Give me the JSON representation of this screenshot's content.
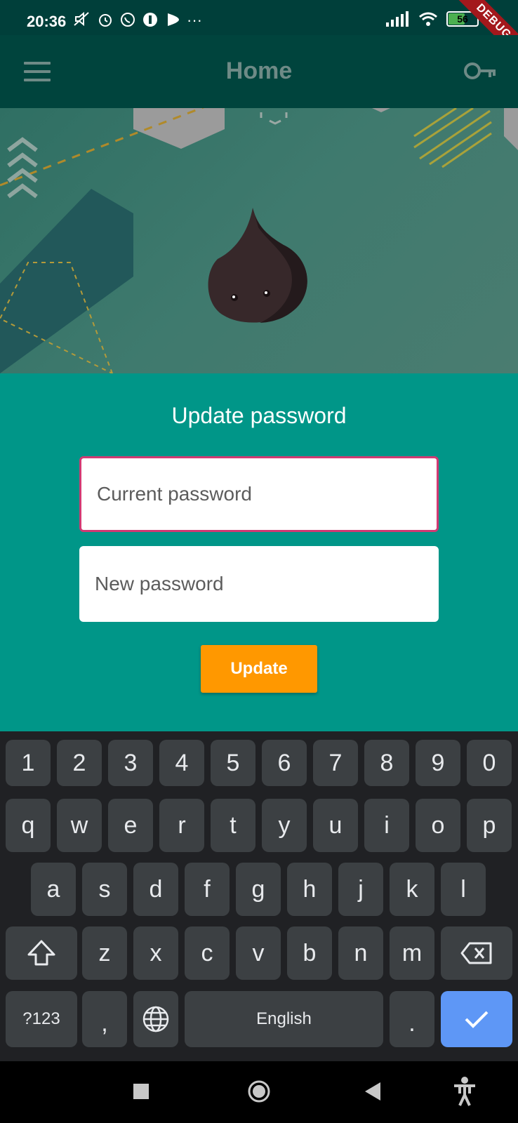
{
  "status_bar": {
    "time": "20:36",
    "icons": [
      "mute-icon",
      "alarm-icon",
      "whatsapp-icon",
      "app-icon",
      "play-icon",
      "more-dots-icon"
    ],
    "more": "···",
    "battery": "56",
    "signal": "signal-icon",
    "wifi": "wifi-icon"
  },
  "debug_ribbon": "DEBUG",
  "app_bar": {
    "title": "Home",
    "menu_icon": "menu-icon",
    "action_icon": "key-icon"
  },
  "form": {
    "title": "Update password",
    "current_password_placeholder": "Current password",
    "new_password_placeholder": "New password",
    "update_label": "Update"
  },
  "keyboard": {
    "row_numbers": [
      "1",
      "2",
      "3",
      "4",
      "5",
      "6",
      "7",
      "8",
      "9",
      "0"
    ],
    "row_q": [
      "q",
      "w",
      "e",
      "r",
      "t",
      "y",
      "u",
      "i",
      "o",
      "p"
    ],
    "row_a": [
      "a",
      "s",
      "d",
      "f",
      "g",
      "h",
      "j",
      "k",
      "l"
    ],
    "row_z": [
      "z",
      "x",
      "c",
      "v",
      "b",
      "n",
      "m"
    ],
    "symbols_label": "?123",
    "comma": ",",
    "space_label": "English",
    "period": "."
  },
  "colors": {
    "app_bar": "#00443d",
    "panel": "#009688",
    "focus_border": "#d13a73",
    "button": "#ff9800",
    "keyboard_bg": "#202124",
    "key_bg": "#3c4043",
    "enter": "#5e97f6"
  }
}
